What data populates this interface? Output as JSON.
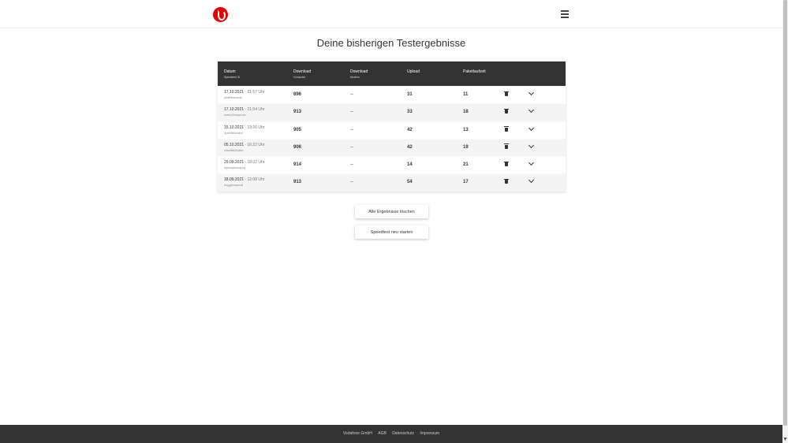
{
  "page_title": "Deine bisherigen Testergebnisse",
  "table": {
    "headers": [
      {
        "main": "Datum",
        "sub": "Speedtest ID"
      },
      {
        "main": "Download",
        "sub": "Computer"
      },
      {
        "main": "Download",
        "sub": "Modem"
      },
      {
        "main": "Upload",
        "sub": ""
      },
      {
        "main": "Paketlaufzeit",
        "sub": ""
      }
    ],
    "rows": [
      {
        "date": "17.10.2021",
        "time": "21:57 Uhr",
        "id": "ykdfhbrusmo",
        "download_computer": "896",
        "download_modem": "--",
        "upload": "31",
        "latency": "11"
      },
      {
        "date": "17.10.2021",
        "time": "21:54 Uhr",
        "id": "xsbxd2mcpmdc",
        "download_computer": "913",
        "download_modem": "--",
        "upload": "33",
        "latency": "18"
      },
      {
        "date": "15.10.2021",
        "time": "19:26 Uhr",
        "id": "2pb39fcbnkcr",
        "download_computer": "905",
        "download_modem": "--",
        "upload": "42",
        "latency": "13"
      },
      {
        "date": "05.10.2021",
        "time": "16:22 Uhr",
        "id": "chsofltb2cdkn",
        "download_computer": "906",
        "download_modem": "--",
        "upload": "42",
        "latency": "19"
      },
      {
        "date": "29.09.2021",
        "time": "18:02 Uhr",
        "id": "wpnwybzxdyxq",
        "download_computer": "914",
        "download_modem": "--",
        "upload": "14",
        "latency": "21"
      },
      {
        "date": "18.09.2021",
        "time": "12:08 Uhr",
        "id": "hsgyjtvsqmv8",
        "download_computer": "913",
        "download_modem": "--",
        "upload": "54",
        "latency": "17"
      }
    ]
  },
  "buttons": {
    "delete_all": "Alle Ergebnisse löschen",
    "restart": "Speedtest neu starten"
  },
  "footer": {
    "links": [
      "Vodafone GmbH",
      "AGB",
      "Datenschutz",
      "Impressum"
    ]
  },
  "colors": {
    "brand": "#e60000",
    "header_bg": "#333333",
    "footer_bg": "#333333"
  },
  "icons": {
    "logo": "vodafone-logo",
    "menu": "hamburger-menu-icon",
    "row_delete": "trash-icon",
    "row_expand": "chevron-down-icon"
  }
}
